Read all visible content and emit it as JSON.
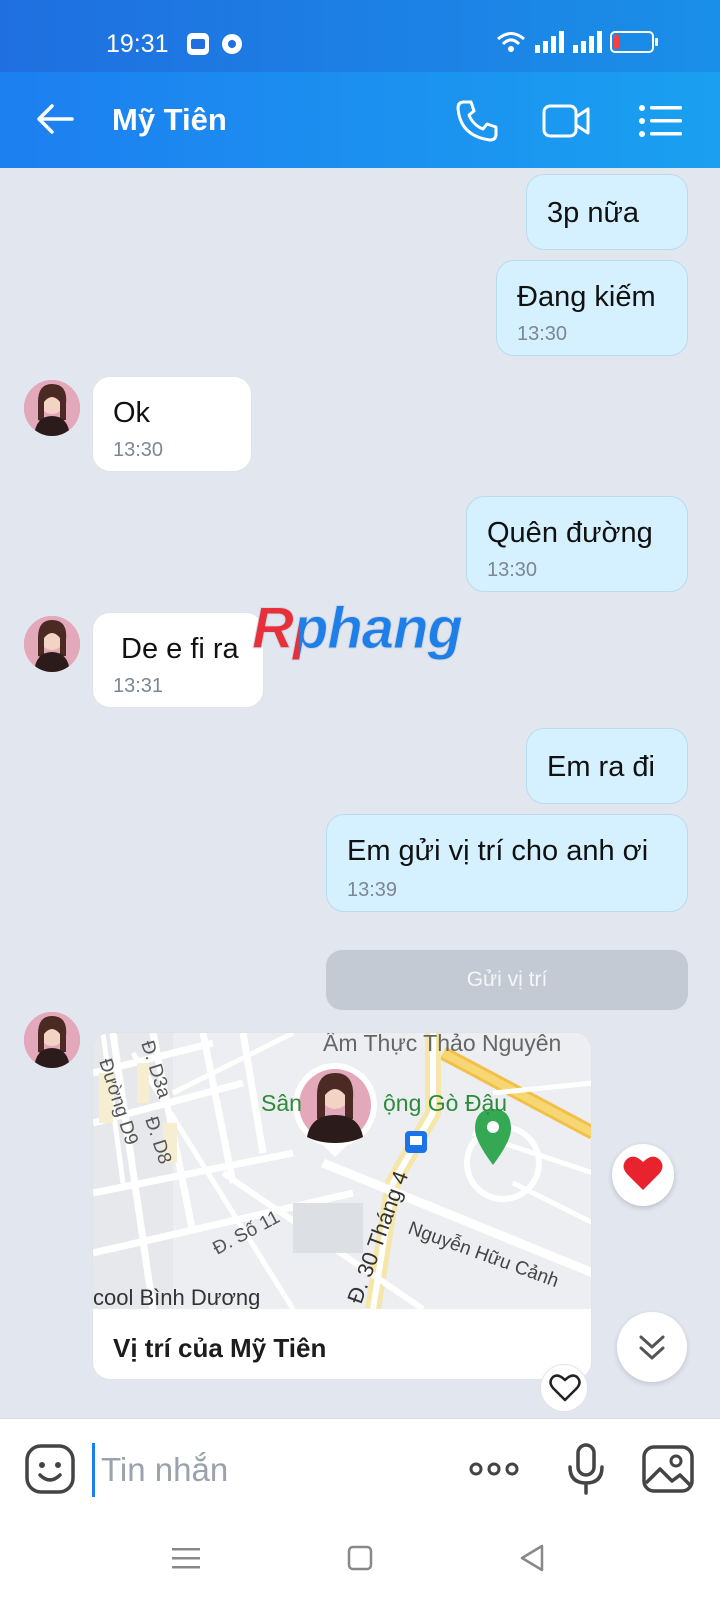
{
  "status": {
    "time": "19:31",
    "battery_level": 0.15
  },
  "header": {
    "contact_name": "Mỹ Tiên",
    "accent": "#1d7ff0"
  },
  "messages": [
    {
      "type": "sent",
      "text": "3p nữa"
    },
    {
      "type": "sent",
      "text": "Đang kiếm",
      "time": "13:30"
    },
    {
      "type": "received",
      "text": "Ok",
      "time": "13:30"
    },
    {
      "type": "sent",
      "text": "Quên đường",
      "time": "13:30"
    },
    {
      "type": "received",
      "text": "De e fi ra",
      "time": "13:31"
    },
    {
      "type": "sent",
      "text": "Em ra đi"
    },
    {
      "type": "sent",
      "text": "Em gửi vị trí cho anh ơi",
      "time": "13:39"
    }
  ],
  "send_location_button": "Gửi vị trí",
  "location_card": {
    "caption": "Vị trí của Mỹ Tiên",
    "map_labels": {
      "place_top": "Ẩm Thực Thảo Nguyên",
      "place_green_a": "Sân",
      "place_green_b": "ộng Gò Đậu",
      "street_d3a": "Đ. D3a",
      "street_d9": "Đường D9",
      "street_d8": "Đ. D8",
      "street_so11": "Đ. Số 11",
      "street_30thang4": "Đ. 30 Tháng 4",
      "street_nhc": "Nguyễn Hữu Cảnh",
      "school": "cool Bình Dương"
    }
  },
  "watermark": "Rphang",
  "input": {
    "placeholder": "Tin nhắn"
  }
}
